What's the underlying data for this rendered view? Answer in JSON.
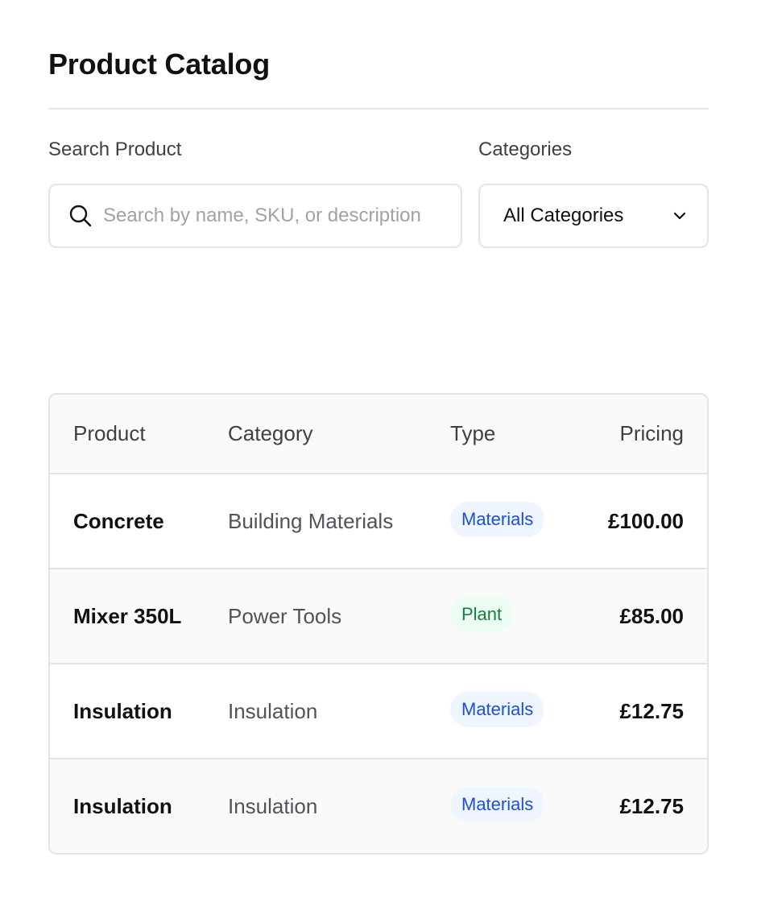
{
  "page": {
    "title": "Product Catalog"
  },
  "filters": {
    "search_label": "Search Product",
    "search_placeholder": "Search by name, SKU, or description",
    "search_value": "",
    "search_icon": "search-icon",
    "category_label": "Categories",
    "category_selected": "All Categories",
    "category_icon": "chevron-down-icon"
  },
  "table": {
    "headers": {
      "product": "Product",
      "category": "Category",
      "type": "Type",
      "pricing": "Pricing"
    },
    "rows": [
      {
        "product": "Concrete",
        "category": "Building Materials",
        "type": "Materials",
        "price": "£100.00"
      },
      {
        "product": "Mixer 350L",
        "category": "Power Tools",
        "type": "Plant",
        "price": "£85.00"
      },
      {
        "product": "Insulation",
        "category": "Insulation",
        "type": "Materials",
        "price": "£12.75"
      },
      {
        "product": "Insulation",
        "category": "Insulation",
        "type": "Materials",
        "price": "£12.75"
      }
    ]
  },
  "colors": {
    "badge_materials_bg": "#eff6ff",
    "badge_materials_text": "#1d4ed8",
    "badge_plant_bg": "#ecfdf3",
    "badge_plant_text": "#15803d",
    "border": "#e4e4e7"
  }
}
